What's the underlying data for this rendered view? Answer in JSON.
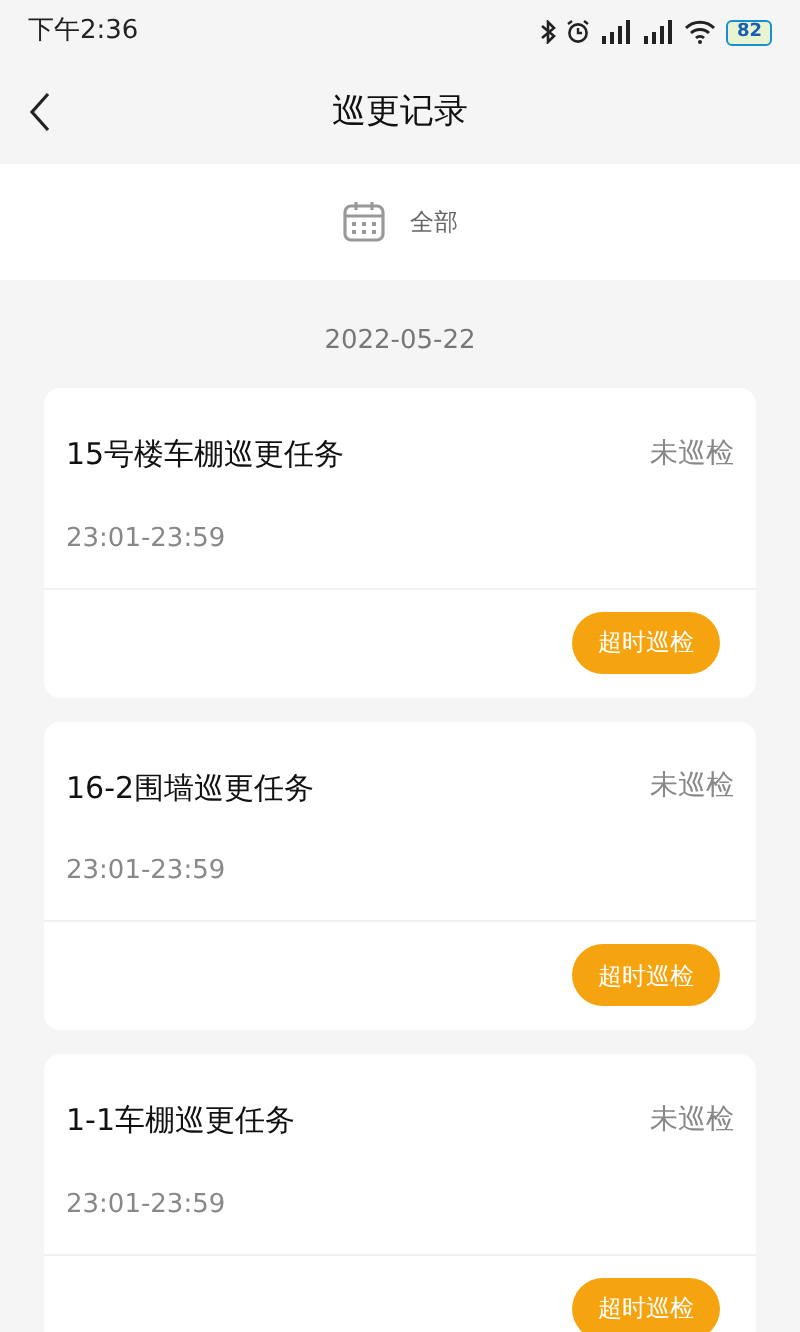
{
  "status_bar": {
    "time": "下午2:36",
    "battery": "82"
  },
  "header": {
    "title": "巡更记录"
  },
  "filter": {
    "label": "全部"
  },
  "date": "2022-05-22",
  "tasks": [
    {
      "title": "15号楼车棚巡更任务",
      "status": "未巡检",
      "time": "23:01-23:59",
      "action": "超时巡检"
    },
    {
      "title": "16-2围墙巡更任务",
      "status": "未巡检",
      "time": "23:01-23:59",
      "action": "超时巡检"
    },
    {
      "title": "1-1车棚巡更任务",
      "status": "未巡检",
      "time": "23:01-23:59",
      "action": "超时巡检"
    }
  ]
}
